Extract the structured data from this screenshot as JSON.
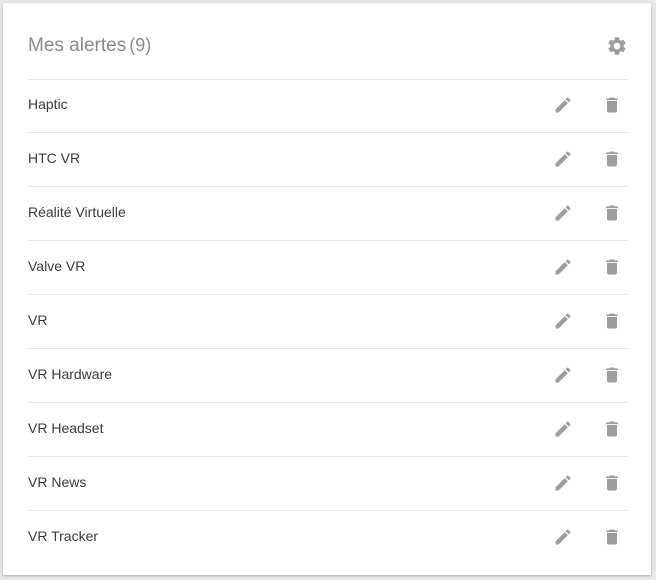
{
  "header": {
    "title": "Mes alertes",
    "count": "(9)",
    "settings_icon": "gear-icon"
  },
  "alerts": [
    {
      "label": "Haptic"
    },
    {
      "label": "HTC VR"
    },
    {
      "label": "Réalité Virtuelle"
    },
    {
      "label": "Valve VR"
    },
    {
      "label": "VR"
    },
    {
      "label": "VR Hardware"
    },
    {
      "label": "VR Headset"
    },
    {
      "label": "VR News"
    },
    {
      "label": "VR Tracker"
    }
  ],
  "icons": {
    "edit": "pencil-icon",
    "delete": "trash-icon"
  },
  "colors": {
    "icon": "#9e9e9e",
    "title": "#8a8a8a",
    "text": "#3a3a3a",
    "divider": "#e6e6e6"
  }
}
